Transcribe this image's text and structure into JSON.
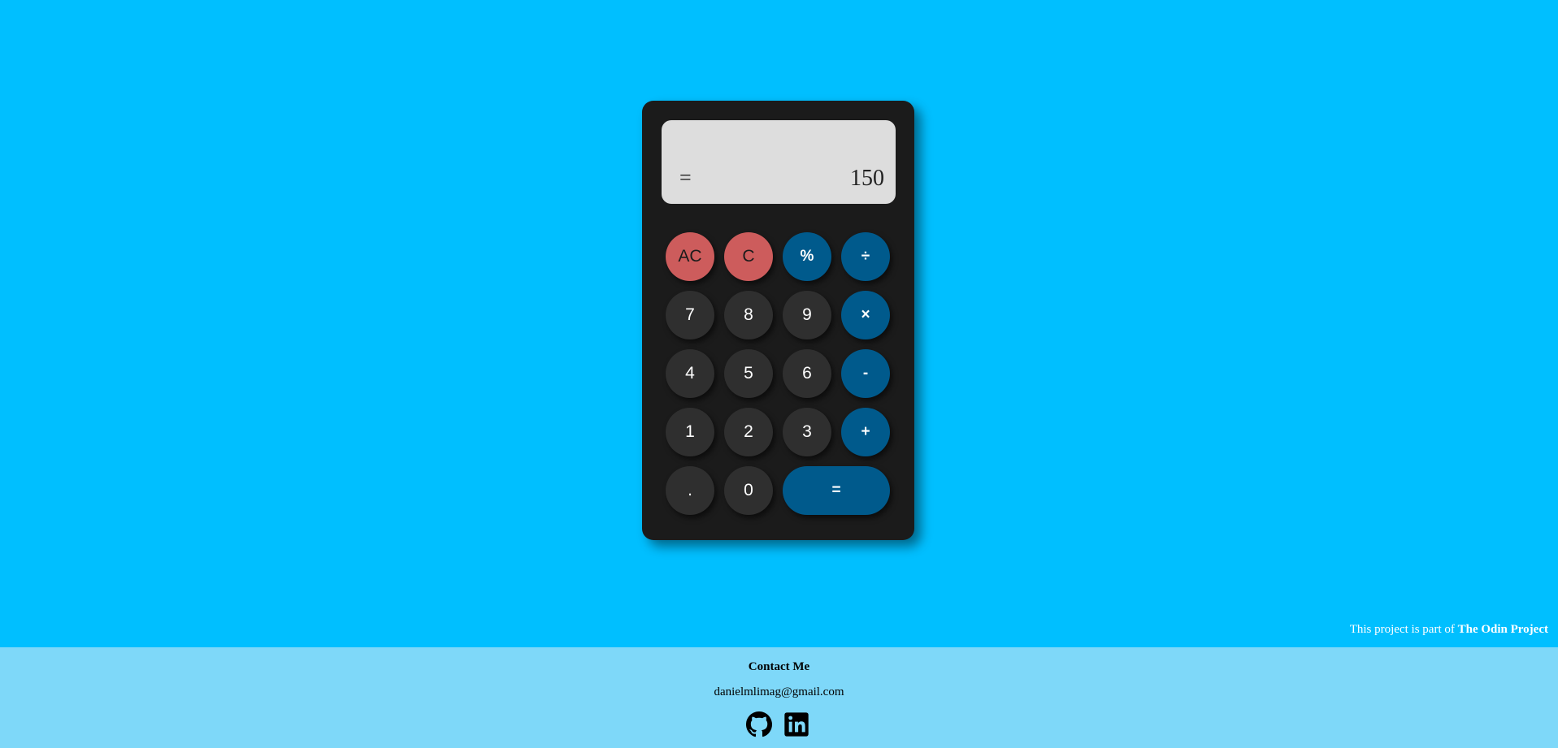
{
  "display": {
    "operator": "=",
    "value": "150"
  },
  "keys": {
    "all_clear": "AC",
    "clear": "C",
    "percent": "%",
    "divide": "÷",
    "seven": "7",
    "eight": "8",
    "nine": "9",
    "multiply": "×",
    "four": "4",
    "five": "5",
    "six": "6",
    "subtract": "-",
    "one": "1",
    "two": "2",
    "three": "3",
    "add": "+",
    "decimal": ".",
    "zero": "0",
    "equals": "="
  },
  "credit": {
    "prefix": "This project is part of",
    "link": "The Odin Project"
  },
  "footer": {
    "title": "Contact Me",
    "email": "danielmlimag@gmail.com",
    "icons": [
      "github-icon",
      "linkedin-icon"
    ]
  },
  "colors": {
    "background": "#00bfff",
    "calculator_body": "#1b1b1b",
    "display": "#dddddd",
    "clear_keys": "#cd5c5c",
    "number_keys": "#2f2f2f",
    "operator_keys": "#005a8c",
    "footer": "#7ed8f9"
  }
}
